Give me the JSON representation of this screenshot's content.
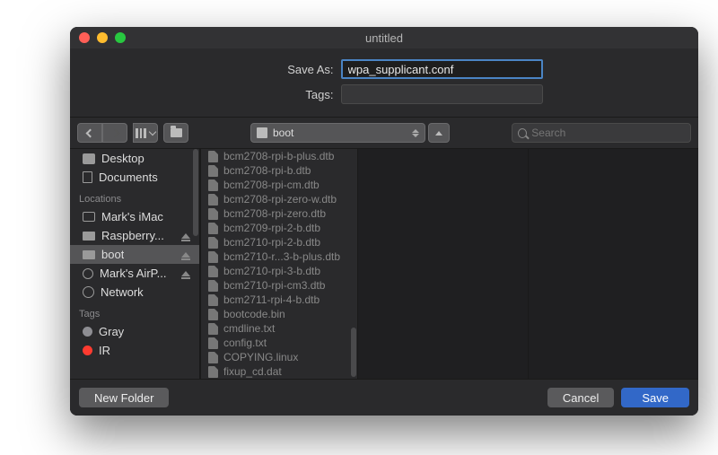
{
  "window": {
    "title": "untitled"
  },
  "form": {
    "save_as_label": "Save As:",
    "save_as_value": "wpa_supplicant.conf",
    "tags_label": "Tags:"
  },
  "toolbar": {
    "location_name": "boot",
    "search_placeholder": "Search"
  },
  "sidebar": {
    "favorites": [
      {
        "label": "Desktop",
        "icon": "desktop"
      },
      {
        "label": "Documents",
        "icon": "doc"
      }
    ],
    "locations_heading": "Locations",
    "locations": [
      {
        "label": "Mark's iMac",
        "icon": "imac",
        "eject": false
      },
      {
        "label": "Raspberry...",
        "icon": "disk",
        "eject": true
      },
      {
        "label": "boot",
        "icon": "disk",
        "eject": true,
        "selected": true
      },
      {
        "label": "Mark's AirP...",
        "icon": "time",
        "eject": true
      },
      {
        "label": "Network",
        "icon": "net",
        "eject": false
      }
    ],
    "tags_heading": "Tags",
    "tags": [
      {
        "label": "Gray",
        "color": "#8e8e93"
      },
      {
        "label": "IR",
        "color": "#ff3b30"
      }
    ]
  },
  "files": [
    "bcm2708-rpi-b-plus.dtb",
    "bcm2708-rpi-b.dtb",
    "bcm2708-rpi-cm.dtb",
    "bcm2708-rpi-zero-w.dtb",
    "bcm2708-rpi-zero.dtb",
    "bcm2709-rpi-2-b.dtb",
    "bcm2710-rpi-2-b.dtb",
    "bcm2710-r...3-b-plus.dtb",
    "bcm2710-rpi-3-b.dtb",
    "bcm2710-rpi-cm3.dtb",
    "bcm2711-rpi-4-b.dtb",
    "bootcode.bin",
    "cmdline.txt",
    "config.txt",
    "COPYING.linux",
    "fixup_cd.dat"
  ],
  "footer": {
    "new_folder": "New Folder",
    "cancel": "Cancel",
    "save": "Save"
  }
}
